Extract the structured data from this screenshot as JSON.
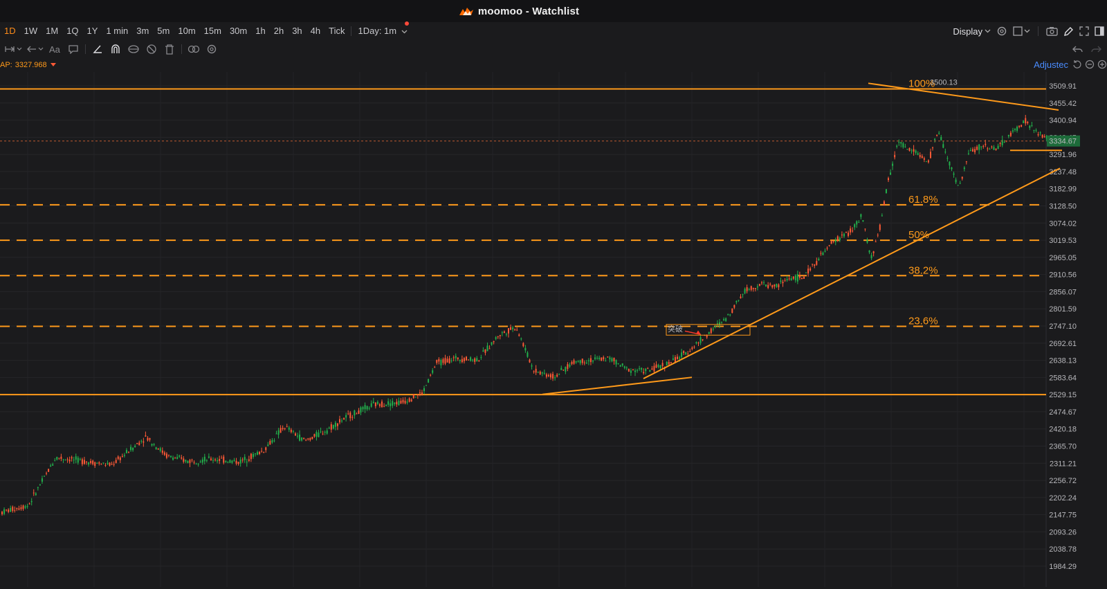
{
  "window": {
    "app_name": "moomoo - Watchlist"
  },
  "toolbar": {
    "timeframes": [
      "1D",
      "1W",
      "1M",
      "1Q",
      "1Y",
      "1 min",
      "3m",
      "5m",
      "10m",
      "15m",
      "30m",
      "1h",
      "2h",
      "3h",
      "4h",
      "Tick"
    ],
    "active_timeframe": "1D",
    "interval_select": "1Day: 1m",
    "display_label": "Display"
  },
  "indicator": {
    "label": "AP:",
    "value": "3327.968"
  },
  "adjusted_label": "Adjustec",
  "colors": {
    "up": "#22b14c",
    "down": "#ff5a36",
    "accent": "#ff9a1a",
    "background": "#1b1b1d"
  },
  "chart_data": {
    "type": "candlestick",
    "y_ticks": [
      "3509.91",
      "3455.42",
      "3400.94",
      "3346.45",
      "3291.96",
      "3237.48",
      "3182.99",
      "3128.50",
      "3074.02",
      "3019.53",
      "2965.05",
      "2910.56",
      "2856.07",
      "2801.59",
      "2747.10",
      "2692.61",
      "2638.13",
      "2583.64",
      "2529.15",
      "2474.67",
      "2420.18",
      "2365.70",
      "2311.21",
      "2256.72",
      "2202.24",
      "2147.75",
      "2093.26",
      "2038.78",
      "1984.29"
    ],
    "last_price": "3334.67",
    "high_annotation": "3500.13",
    "fib_levels": [
      {
        "label": "100%",
        "price": 3500.13
      },
      {
        "label": "61.8%",
        "price": 3132
      },
      {
        "label": "50%",
        "price": 3019.53
      },
      {
        "label": "38.2%",
        "price": 2907
      },
      {
        "label": "23.6%",
        "price": 2746
      }
    ],
    "support_line_price": 2529.15,
    "annotation_text": "突破",
    "grid": true
  }
}
